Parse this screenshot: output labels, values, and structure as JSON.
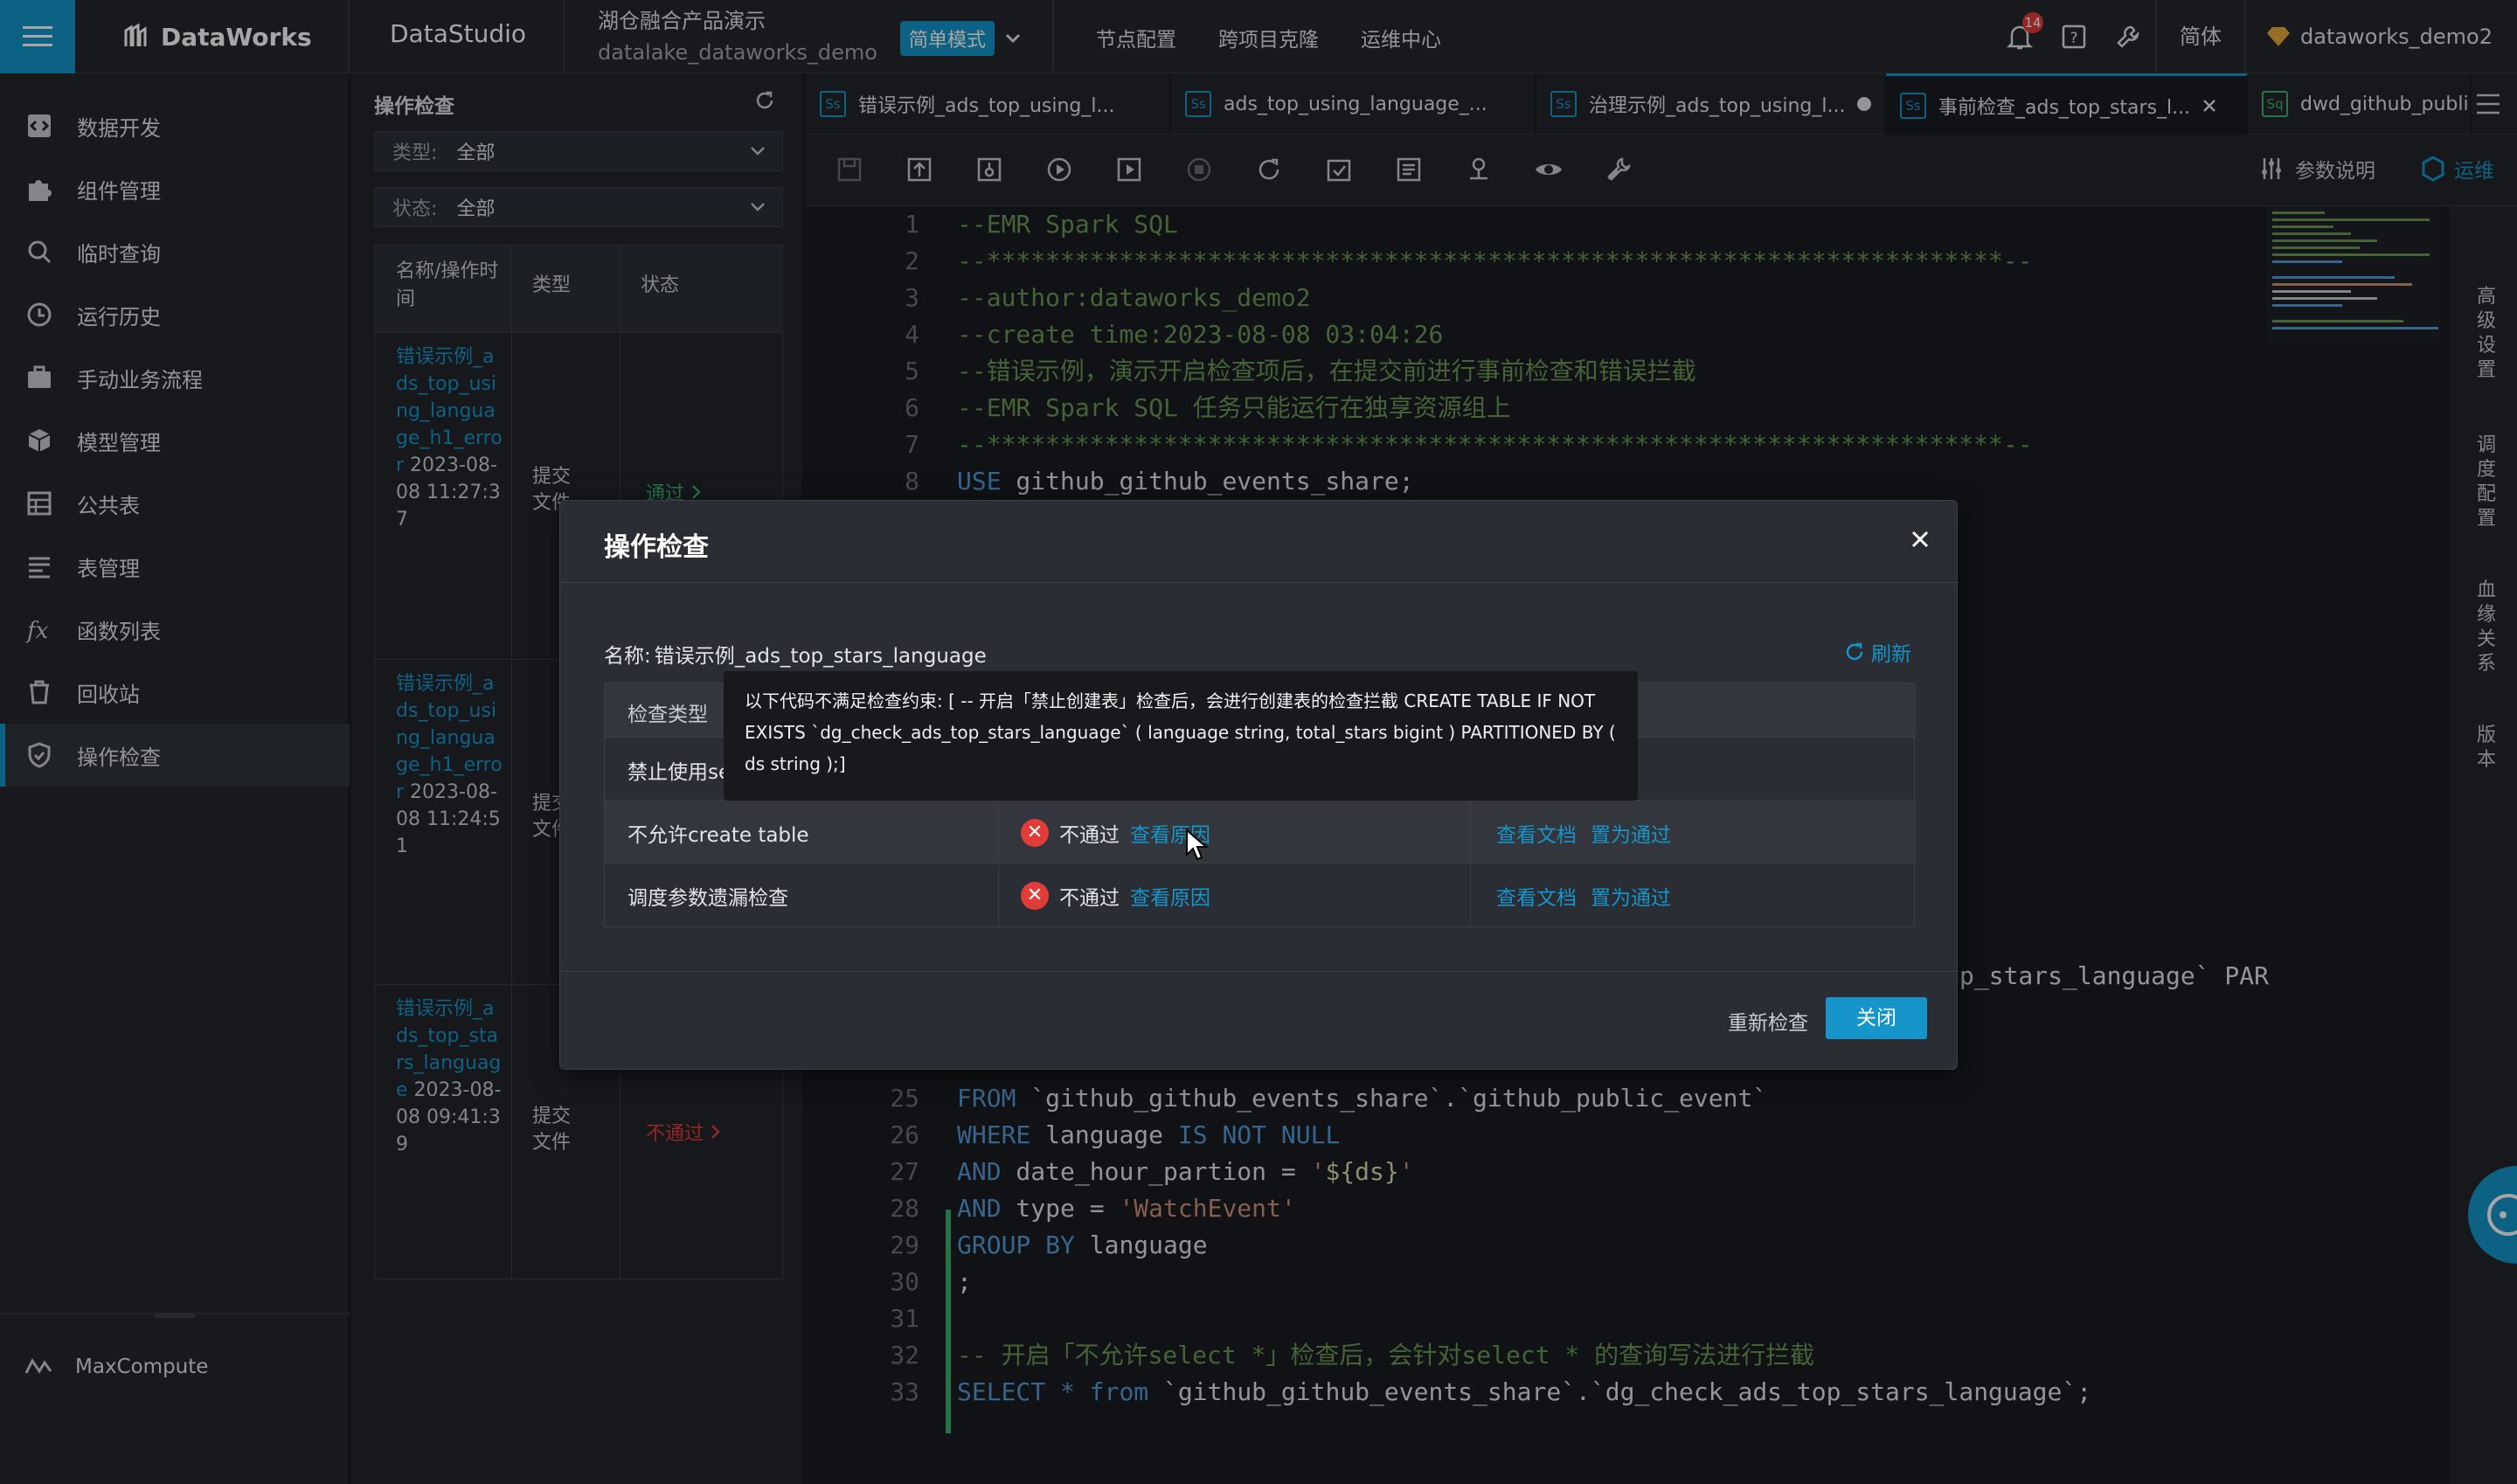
{
  "topbar": {
    "product": "DataWorks",
    "studio": "DataStudio",
    "project_title": "湖仓融合产品演示",
    "project_sub": "datalake_dataworks_demo",
    "mode_label": "简单模式",
    "nav": [
      "节点配置",
      "跨项目克隆",
      "运维中心"
    ],
    "notification_count": "14",
    "lang": "简体",
    "user": "dataworks_demo2"
  },
  "sidebar": {
    "items": [
      {
        "label": "数据开发",
        "icon": "code-icon"
      },
      {
        "label": "组件管理",
        "icon": "puzzle-icon"
      },
      {
        "label": "临时查询",
        "icon": "search-icon"
      },
      {
        "label": "运行历史",
        "icon": "clock-icon"
      },
      {
        "label": "手动业务流程",
        "icon": "briefcase-icon"
      },
      {
        "label": "模型管理",
        "icon": "cube-icon"
      },
      {
        "label": "公共表",
        "icon": "table-icon"
      },
      {
        "label": "表管理",
        "icon": "list-icon"
      },
      {
        "label": "函数列表",
        "icon": "function-icon"
      },
      {
        "label": "回收站",
        "icon": "trash-icon"
      },
      {
        "label": "操作检查",
        "icon": "shield-icon"
      }
    ],
    "active_index": 10,
    "bottom": "MaxCompute"
  },
  "check_panel": {
    "title": "操作检查",
    "type_filter": {
      "label": "类型:",
      "value": "全部"
    },
    "status_filter": {
      "label": "状态:",
      "value": "全部"
    },
    "columns": {
      "name": "名称/操作时间",
      "type": "类型",
      "status": "状态"
    },
    "rows": [
      {
        "name": "错误示例_ads_top_using_language_h1_error",
        "time": "2023-08-08 11:27:37",
        "type": "提交文件",
        "status": "通过"
      },
      {
        "name": "错误示例_ads_top_using_language_h1_error",
        "time": "2023-08-08 11:24:51",
        "type": "提交文件",
        "status": ""
      },
      {
        "name": "错误示例_ads_top_stars_language",
        "time": "2023-08-08 09:41:39",
        "type": "提交文件",
        "status": "不通过"
      }
    ]
  },
  "tabs": [
    {
      "badge": "Ss",
      "label": "错误示例_ads_top_using_l..."
    },
    {
      "badge": "Ss",
      "label": "ads_top_using_language_..."
    },
    {
      "badge": "Ss",
      "label": "治理示例_ads_top_using_l..."
    },
    {
      "badge": "Ss",
      "label": "事前检查_ads_top_stars_l..."
    },
    {
      "badge": "Sq",
      "label": "dwd_github_publi"
    }
  ],
  "toolbar": {
    "param_label": "参数说明",
    "ops_label": "运维"
  },
  "code": {
    "lines": [
      {
        "n": "1",
        "t": "--EMR Spark SQL"
      },
      {
        "n": "2",
        "t": "--*********************************************************************--"
      },
      {
        "n": "3",
        "t": "--author:dataworks_demo2"
      },
      {
        "n": "4",
        "t": "--create time:2023-08-08 03:04:26"
      },
      {
        "n": "5",
        "t": "--错误示例，演示开启检查项后，在提交前进行事前检查和错误拦截"
      },
      {
        "n": "6",
        "t": "--EMR Spark SQL 任务只能运行在独享资源组上"
      },
      {
        "n": "7",
        "t": "--*********************************************************************--"
      },
      {
        "n": "8",
        "t": "USE github_github_events_share;"
      },
      {
        "n": "25",
        "t": "FROM `github_github_events_share`.`github_public_event`"
      },
      {
        "n": "26",
        "t": "WHERE language IS NOT NULL"
      },
      {
        "n": "27",
        "t": "AND date_hour_partion = '${ds}'"
      },
      {
        "n": "28",
        "t": "AND type = 'WatchEvent'"
      },
      {
        "n": "29",
        "t": "GROUP BY language"
      },
      {
        "n": "30",
        "t": ";"
      },
      {
        "n": "31",
        "t": ""
      },
      {
        "n": "32",
        "t": "-- 开启「不允许select *」检查后，会针对select * 的查询写法进行拦截"
      },
      {
        "n": "33",
        "t": "SELECT * from `github_github_events_share`.`dg_check_ads_top_stars_language`;"
      }
    ],
    "peek_text": "p_stars_language` PAR"
  },
  "right_vertical": [
    "高级设置",
    "调度配置",
    "血缘关系",
    "版本"
  ],
  "modal": {
    "title": "操作检查",
    "name_label": "名称:",
    "name_value": "错误示例_ads_top_stars_language",
    "refresh": "刷新",
    "header_first": "检查类型",
    "rows": [
      {
        "type": "禁止使用se"
      },
      {
        "type": "不允许create table",
        "result": "不通过",
        "reason": "查看原因",
        "doc": "查看文档",
        "pass": "置为通过"
      },
      {
        "type": "调度参数遗漏检查",
        "result": "不通过",
        "reason": "查看原因",
        "doc": "查看文档",
        "pass": "置为通过"
      }
    ],
    "recheck": "重新检查",
    "close": "关闭",
    "tooltip_text": "以下代码不满足检查约束: [ -- 开启「禁止创建表」检查后，会进行创建表的检查拦截 CREATE TABLE IF NOT EXISTS `dg_check_ads_top_stars_language` ( language string, total_stars bigint ) PARTITIONED BY ( ds string );]"
  },
  "colors": {
    "accent": "#1595c9",
    "fail": "#e23c39",
    "bg": "#1b1d22",
    "comment": "#6a9955",
    "keyword": "#569cd6"
  }
}
